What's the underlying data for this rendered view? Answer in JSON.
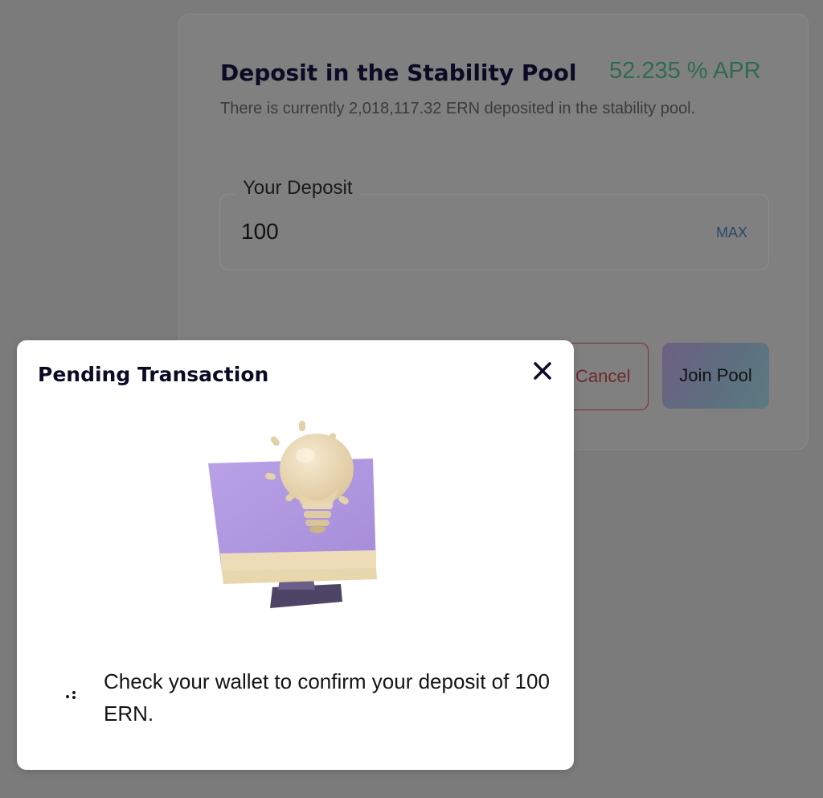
{
  "deposit_card": {
    "title": "Deposit in the Stability Pool",
    "apr": "52.235 % APR",
    "subtitle": "There is currently 2,018,117.32 ERN deposited in the stability pool.",
    "deposit_field": {
      "label": "Your Deposit",
      "value": "100",
      "max_label": "MAX"
    },
    "cancel_label": "Cancel",
    "join_label": "Join Pool"
  },
  "modal": {
    "title": "Pending Transaction",
    "close_icon": "close-icon",
    "illustration_icon": "lightbulb-monitor-icon",
    "spinner_icon": "loading-spinner-icon",
    "message": "Check your wallet to confirm your deposit of 100 ERN."
  },
  "colors": {
    "overlay": "#7b7b7b",
    "apr_green": "#3aa171",
    "title_navy": "#0c0b25",
    "cancel_red": "#c0392b",
    "illustration_purple": "#b49de3",
    "illustration_cream": "#ecdcb7"
  }
}
